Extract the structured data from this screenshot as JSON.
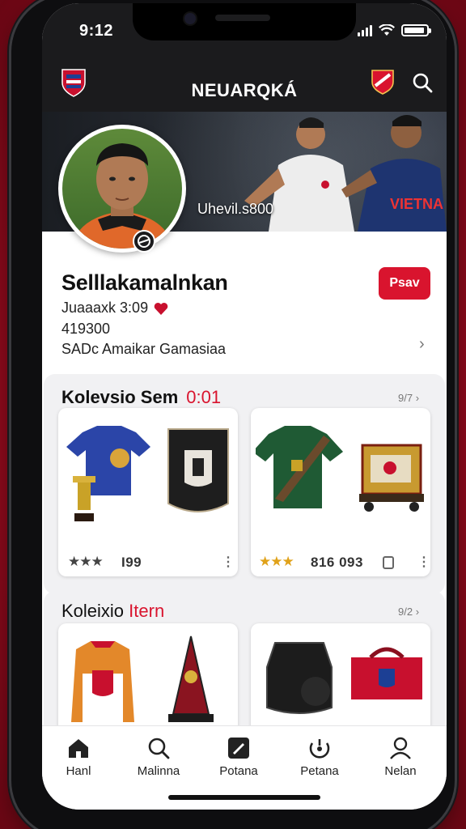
{
  "status_bar": {
    "time": "9:12"
  },
  "app_bar": {
    "title": "NEUARQKÁ",
    "left_icon": "club-crest-icon",
    "right_icons": [
      "club-crest-icon",
      "search-icon"
    ]
  },
  "banner": {
    "caption": "Uhevil.s800"
  },
  "profile": {
    "name": "Selllakamalnkan",
    "stat_line_1": "Juaaaxk 3:09",
    "stat_line_2": "419300",
    "stat_line_3": "SADc Amaikar  Gamasiaa",
    "follow_label": "Psav"
  },
  "sections": [
    {
      "title": "Kolevsio Sem",
      "accent": "0:01",
      "meta": "9/7",
      "cards": [
        {
          "rating": "★★★",
          "price": "I99",
          "image": "jersey-and-shield-icon"
        },
        {
          "rating": "★★★",
          "price": "816 093",
          "image": "green-jersey-and-cart-icon"
        }
      ]
    },
    {
      "title_prefix": "Koleixio",
      "title_accent": "Itern",
      "meta": "9/2",
      "cards": [
        {
          "image": "orange-jersey-and-trophy-icon"
        },
        {
          "image": "vest-and-bag-icon"
        }
      ]
    }
  ],
  "tabs": [
    {
      "label": "Hanl",
      "icon": "home-icon"
    },
    {
      "label": "Malinna",
      "icon": "search-icon"
    },
    {
      "label": "Potana",
      "icon": "pencil-icon"
    },
    {
      "label": "Petana",
      "icon": "activity-icon"
    },
    {
      "label": "Nelan",
      "icon": "profile-icon"
    }
  ],
  "colors": {
    "accent": "#d9142e",
    "appbar": "#1b1b1d",
    "frame_bg": "#b0101f"
  }
}
